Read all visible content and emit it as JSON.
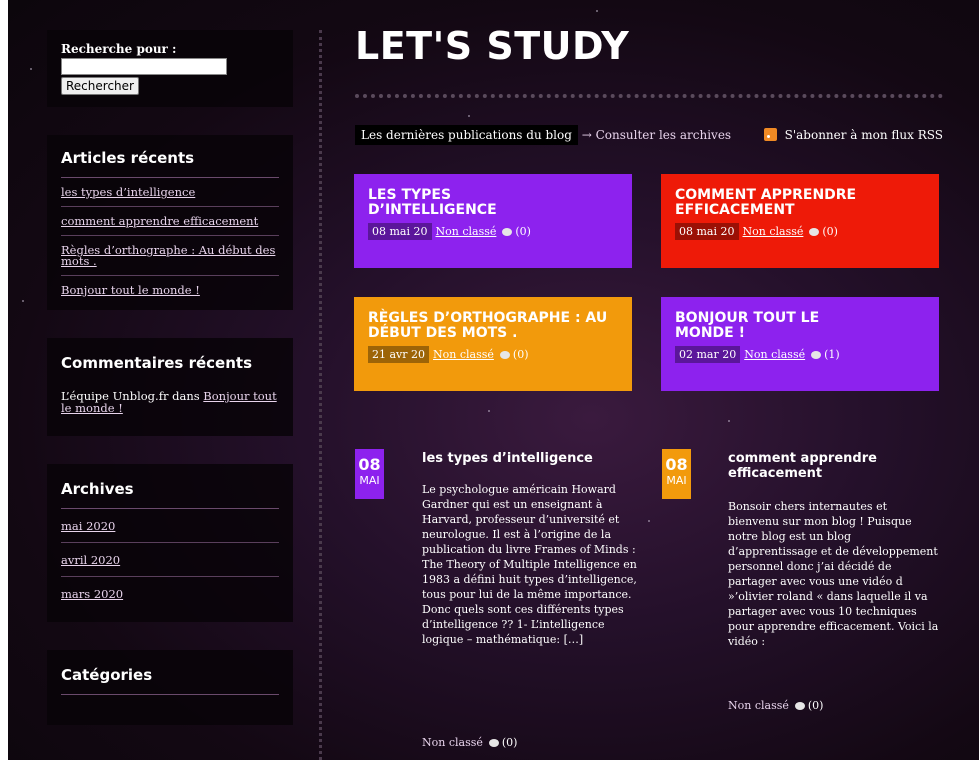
{
  "site": {
    "title": "LET'S STUDY"
  },
  "search": {
    "label": "Recherche pour :",
    "button": "Rechercher",
    "value": ""
  },
  "recent_posts": {
    "title": "Articles récents",
    "items": [
      "les types d’intelligence",
      "comment apprendre efficacement",
      "Règles d’orthographe : Au début des mots .",
      "Bonjour tout le monde !"
    ]
  },
  "recent_comments": {
    "title": "Commentaires récents",
    "author": "L’équipe Unblog.fr",
    "connector": " dans ",
    "link": "Bonjour tout le monde !"
  },
  "archives": {
    "title": "Archives",
    "items": [
      "mai 2020",
      "avril 2020",
      "mars 2020"
    ]
  },
  "categories": {
    "title": "Catégories"
  },
  "latest": {
    "label": "Les dernières publications du blog",
    "archives_link": "→ Consulter les archives",
    "rss": "S'abonner à mon flux RSS"
  },
  "cards": [
    {
      "title": "LES TYPES D’INTELLIGENCE",
      "date": "08 mai 20",
      "category": "Non classé",
      "comments": "(0)",
      "color": "#8d22ee"
    },
    {
      "title": "COMMENT APPRENDRE EFFICACEMENT",
      "date": "08 mai 20",
      "category": "Non classé",
      "comments": "(0)",
      "color": "#ee1a08"
    },
    {
      "title": "RÈGLES D’ORTHOGRAPHE : AU DÉBUT DES MOTS .",
      "date": "21 avr 20",
      "category": "Non classé",
      "comments": "(0)",
      "color": "#f29a0c"
    },
    {
      "title": "BONJOUR TOUT LE MONDE !",
      "date": "02 mar 20",
      "category": "Non classé",
      "comments": "(1)",
      "color": "#8d22ee"
    }
  ],
  "posts": [
    {
      "day": "08",
      "month": "MAI",
      "badge_color": "#8d22ee",
      "title": "les types d’intelligence",
      "excerpt": "Le psychologue américain Howard Gardner qui est un  enseignant à Harvard, professeur d’université et neurologue. Il est à l’origine de la publication du livre Frames of Minds : The Theory of Multiple Intelligence en 1983  a défini huit types d’intelligence, tous pour lui de la même importance. Donc quels sont ces différents types d’intelligence ?? 1- L’intelligence logique – mathématique: […]",
      "category": "Non classé",
      "comments": "(0)"
    },
    {
      "day": "08",
      "month": "MAI",
      "badge_color": "#f29a0c",
      "title": "comment apprendre efficacement",
      "excerpt": "Bonsoir chers internautes et bienvenu sur mon blog ! Puisque notre blog est un blog d’apprentissage et de développement personnel donc j’ai décidé de partager avec vous une vidéo d »’olivier roland « dans laquelle il va partager avec vous      10 techniques pour apprendre efficacement. Voici la vidéo :",
      "category": "Non classé",
      "comments": "(0)"
    }
  ]
}
